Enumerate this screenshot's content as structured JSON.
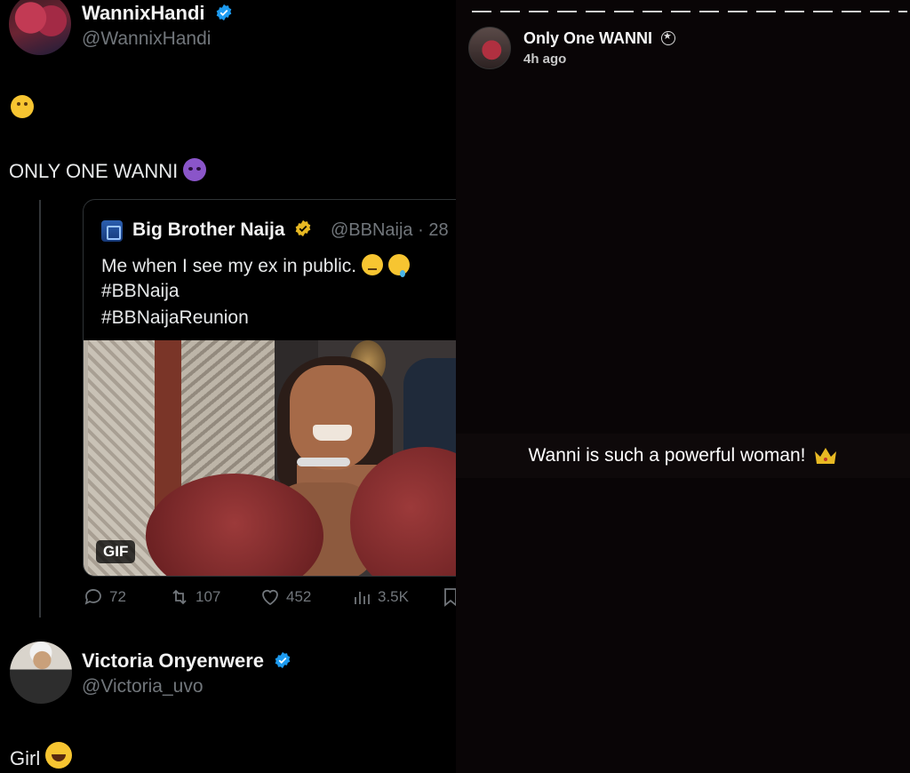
{
  "tweet": {
    "author_name": "WannixHandi",
    "author_handle": "@WannixHandi",
    "line1_emoji": "shushing-face",
    "body": "ONLY ONE WANNI",
    "body_emoji": "smiling-devil"
  },
  "quote": {
    "author_name": "Big Brother Naija",
    "author_handle": "@BBNaija · 28",
    "text_line1": "Me when I see my ex in public.",
    "text_line2": "#BBNaija",
    "text_line3": "#BBNaijaReunion",
    "media_badge": "GIF",
    "stats": {
      "replies": "72",
      "retweets": "107",
      "likes": "452",
      "views": "3.5K"
    }
  },
  "reply": {
    "author_name": "Victoria Onyenwere",
    "author_handle": "@Victoria_uvo",
    "body": "Girl",
    "body_emoji": "tears-of-joy"
  },
  "story": {
    "name": "Only One WANNI",
    "time": "4h ago",
    "caption": "Wanni is such a powerful woman!",
    "caption_emoji": "crown"
  },
  "colors": {
    "background": "#000000",
    "text": "#e7e9ea",
    "secondary_text": "#71767b",
    "verified_blue": "#1d9bf0",
    "verified_gold": "#e8b923"
  }
}
